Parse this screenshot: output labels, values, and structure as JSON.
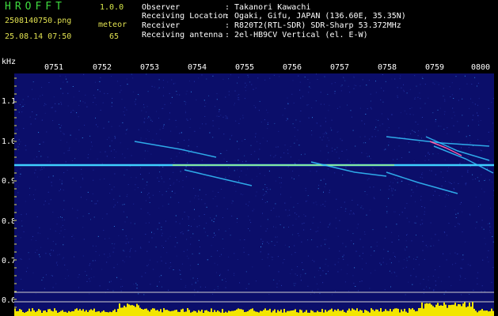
{
  "header": {
    "logo": "HROFFT",
    "version": "1.0.0",
    "filename": "2508140750.png",
    "datetime": "25.08.14 07:50",
    "detection_type": "meteor",
    "detection_count": "65"
  },
  "meta": {
    "observer_label": "Observer",
    "observer_value": ": Takanori Kawachi",
    "location_label": "Receiving Location",
    "location_value": ": Ogaki, Gifu, JAPAN (136.60E, 35.35N)",
    "receiver_label": "Receiver",
    "receiver_value": ": R820T2(RTL-SDR) SDR-Sharp 53.372MHz",
    "antenna_label": "Receiving antenna",
    "antenna_value": ": 2el-HB9CV Vertical (el. E-W)"
  },
  "axis": {
    "unit": "kHz",
    "y_ticks": [
      "1.1",
      "1.0",
      "0.9",
      "0.8",
      "0.7",
      "0.6"
    ],
    "x_ticks": [
      "0751",
      "0752",
      "0753",
      "0754",
      "0755",
      "0756",
      "0757",
      "0758",
      "0759",
      "0800"
    ]
  },
  "colors": {
    "background": "#0b0e6a",
    "carrier": "#3fd0ff",
    "header_green": "#3fdc3f",
    "header_yellow": "#e0e050"
  },
  "chart_data": {
    "type": "heatmap",
    "x_ticks": [
      "0751",
      "0752",
      "0753",
      "0754",
      "0755",
      "0756",
      "0757",
      "0758",
      "0759",
      "0800"
    ],
    "y_range_khz": [
      0.58,
      1.2
    ],
    "y_unit": "kHz",
    "carrier_khz": 0.94,
    "meteor_count": 65
  }
}
